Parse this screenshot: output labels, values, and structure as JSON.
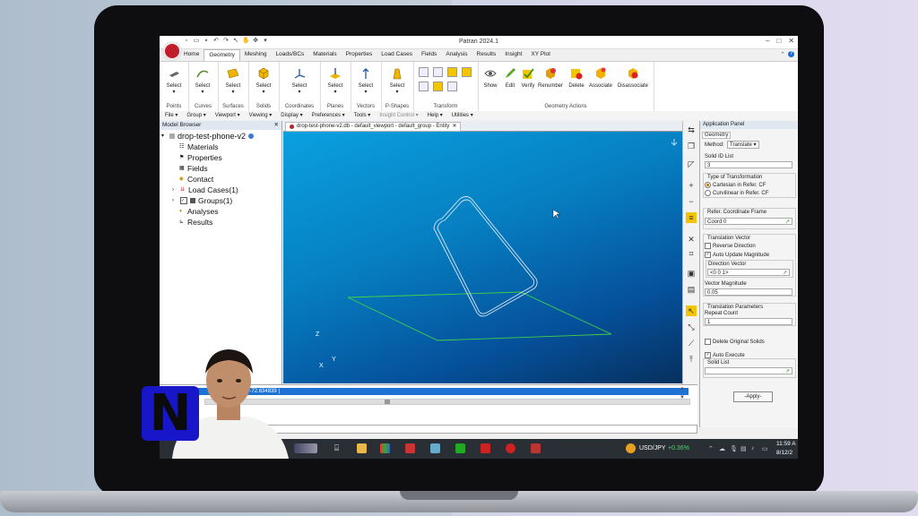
{
  "app": {
    "title": "Patran 2024.1"
  },
  "tabs": [
    "Home",
    "Geometry",
    "Meshing",
    "Loads/BCs",
    "Materials",
    "Properties",
    "Load Cases",
    "Fields",
    "Analysis",
    "Results",
    "Insight",
    "XY Plot"
  ],
  "ribbon": {
    "groups": [
      {
        "label": "Points",
        "button": "Select"
      },
      {
        "label": "Curves",
        "button": "Select"
      },
      {
        "label": "Surfaces",
        "button": "Select"
      },
      {
        "label": "Solids",
        "button": "Select"
      },
      {
        "label": "Coordinates",
        "button": "Select"
      },
      {
        "label": "Planes",
        "button": "Select"
      },
      {
        "label": "Vectors",
        "button": "Select"
      },
      {
        "label": "P-Shapes",
        "button": "Select"
      },
      {
        "label": "Transform"
      }
    ],
    "geometry_actions": {
      "label": "Geometry Actions",
      "buttons": [
        "Show",
        "Edit",
        "Verify",
        "Renumber",
        "Delete",
        "Associate",
        "Disassociate"
      ]
    }
  },
  "menubar": [
    "File ▾",
    "Group ▾",
    "Viewport ▾",
    "Viewing ▾",
    "Display ▾",
    "Preferences ▾",
    "Tools ▾",
    "Insight Control ▾",
    "Help ▾",
    "Utilities ▾"
  ],
  "model_browser": {
    "title": "Model Browser",
    "root": "drop-test-phone-v2",
    "items": [
      "Materials",
      "Properties",
      "Fields",
      "Contact",
      "Load Cases(1)",
      "Groups(1)",
      "Analyses",
      "Results"
    ]
  },
  "viewport": {
    "tab": "drop-test-phone-v2.db - default_viewport - default_group - Entity",
    "axes": {
      "z": "Z",
      "y": "Y",
      "x": "X"
    }
  },
  "app_panel": {
    "title": "Application Panel",
    "section": "Geometry",
    "method_label": "Method:",
    "method_value": "Translate",
    "solid_id_label": "Solid ID List",
    "solid_id_value": "3",
    "type_label": "Type of Transformation",
    "type_opt1": "Cartesian in Refer. CF",
    "type_opt2": "Curvilinear in Refer. CF",
    "refer_label": "Refer. Coordinate Frame",
    "refer_value": "Coord 0",
    "tv_label": "Translation Vector",
    "reverse_label": "Reverse Direction",
    "auto_update_label": "Auto Update Magnitude",
    "dir_label": "Direction Vector",
    "dir_value": "<0 0 1>",
    "mag_label": "Vector Magnitude",
    "mag_value": "0.05",
    "tp_label": "Translation Parameters",
    "repeat_label": "Repeat Count",
    "repeat_value": "1",
    "delete_label": "Delete Original Solids",
    "auto_exec_label": "Auto Execute",
    "solid_list_label": "Solid List",
    "apply_label": "-Apply-"
  },
  "history": {
    "line": "...487167, -72.634839 )"
  },
  "taskbar": {
    "ticker": "USD/JPY",
    "change": "+0.36%",
    "time": "11:59 A",
    "date": "8/12/2"
  },
  "overlay": {
    "logo_letter": "N"
  },
  "colors": {
    "accent": "#f3c400",
    "viewport_top": "#0aa0e0",
    "viewport_bottom": "#07305e",
    "selection": "#1e72d6"
  }
}
